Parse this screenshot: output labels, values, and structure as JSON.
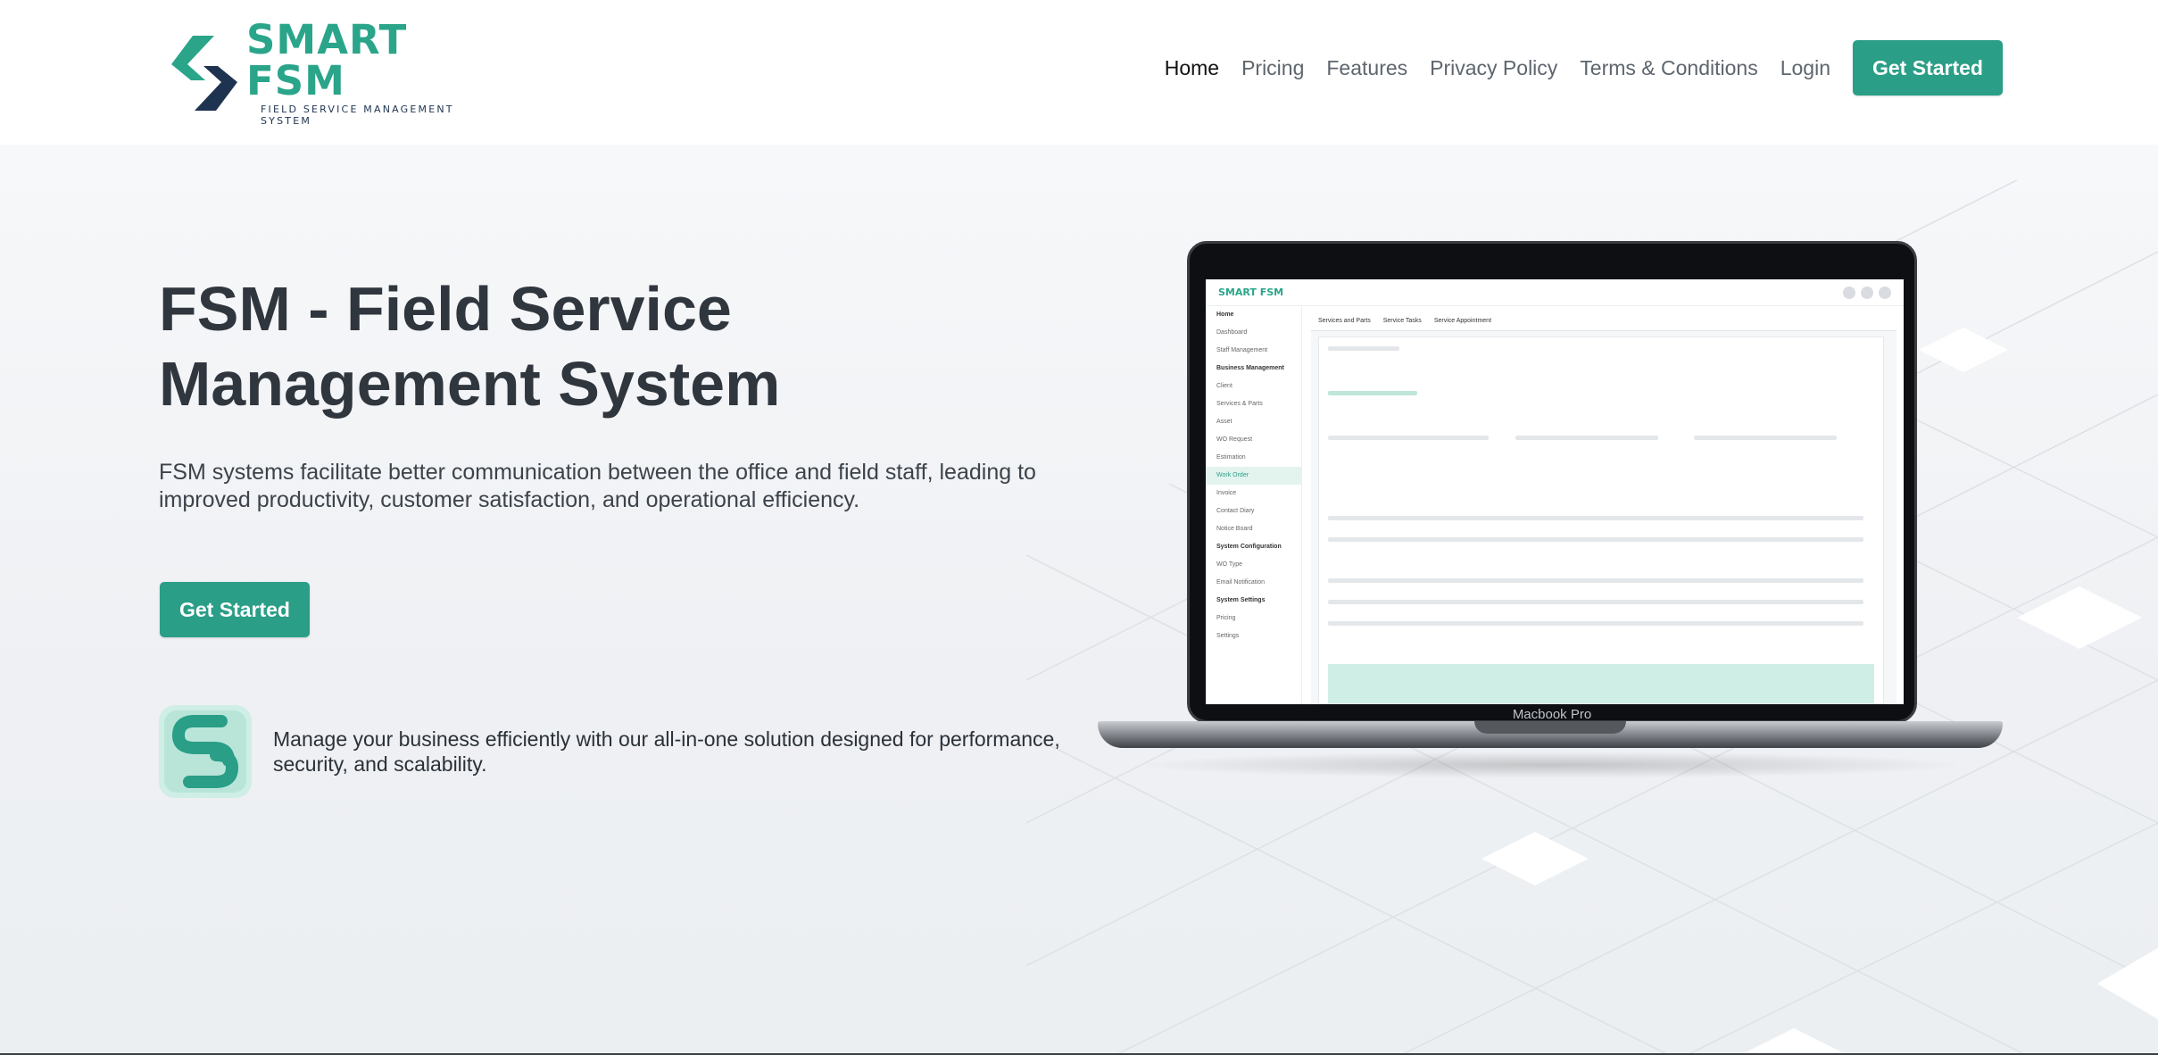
{
  "header": {
    "logo": {
      "title": "SMART FSM",
      "subtitle": "FIELD SERVICE MANAGEMENT SYSTEM"
    },
    "nav": [
      {
        "label": "Home",
        "active": true
      },
      {
        "label": "Pricing",
        "active": false
      },
      {
        "label": "Features",
        "active": false
      },
      {
        "label": "Privacy Policy",
        "active": false
      },
      {
        "label": "Terms & Conditions",
        "active": false
      },
      {
        "label": "Login",
        "active": false
      }
    ],
    "cta_label": "Get Started"
  },
  "hero": {
    "title": "FSM - Field Service Management System",
    "description": "FSM systems facilitate better communication between the office and field staff, leading to improved productivity, customer satisfaction, and operational efficiency.",
    "cta_label": "Get Started",
    "feature_text": "Manage your business efficiently with our all-in-one solution designed for performance, security, and scalability."
  },
  "laptop": {
    "label": "Macbook Pro",
    "app": {
      "logo": "SMART FSM",
      "sidebar": [
        "Home",
        "Dashboard",
        "Staff Management",
        "Business Management",
        "Client",
        "Services & Parts",
        "Asset",
        "WO Request",
        "Estimation",
        "Work Order",
        "Invoice",
        "Contact Diary",
        "Notice Board",
        "System Configuration",
        "WO Type",
        "Email Notification",
        "System Settings",
        "Pricing",
        "Settings"
      ],
      "tabs": [
        "Services and Parts",
        "Service Tasks",
        "Service Appointment"
      ]
    }
  },
  "colors": {
    "accent": "#2a9e86",
    "brand_dark": "#1e3350",
    "text": "#30363d"
  }
}
